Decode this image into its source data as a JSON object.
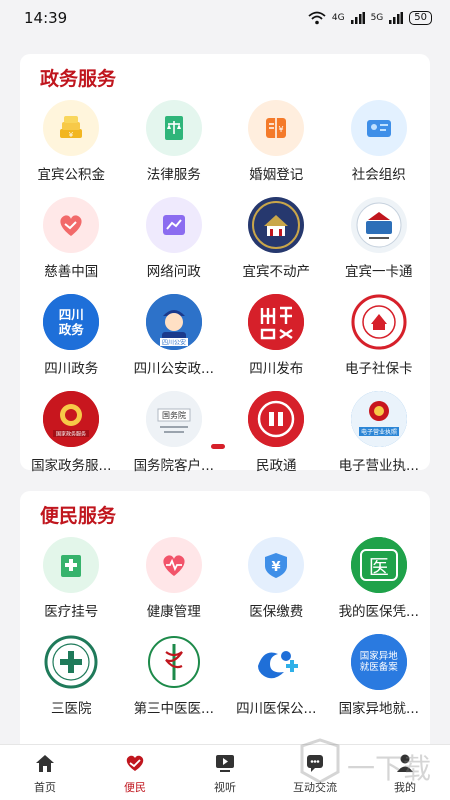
{
  "status_bar": {
    "time": "14:39",
    "signal1": "4G",
    "signal2": "5G",
    "battery": "50"
  },
  "gov_services": {
    "title": "政务服务",
    "items": [
      {
        "label": "宜宾公积金",
        "icon": "coin-stack-icon",
        "bg": "#fff5dc"
      },
      {
        "label": "法律服务",
        "icon": "law-book-icon",
        "bg": "#e4f6ee"
      },
      {
        "label": "婚姻登记",
        "icon": "certificate-book-icon",
        "bg": "#ffeede"
      },
      {
        "label": "社会组织",
        "icon": "id-card-icon",
        "bg": "#e3f1ff"
      },
      {
        "label": "慈善中国",
        "icon": "charity-heart-icon",
        "bg": "#ffe8e8"
      },
      {
        "label": "网络问政",
        "icon": "line-chart-icon",
        "bg": "#efeafd"
      },
      {
        "label": "宜宾不动产",
        "icon": "real-estate-emblem-icon",
        "bg": "#26386e"
      },
      {
        "label": "宜宾一卡通",
        "icon": "social-card-emblem-icon",
        "bg": "#eef3f7"
      },
      {
        "label": "四川政务",
        "icon": "sichuan-gov-logo-icon",
        "bg": "#1e6fd9",
        "logo_text": "四川政务"
      },
      {
        "label": "四川公安政...",
        "icon": "police-officer-icon",
        "bg": "#2d72c9",
        "logo_text": "四川公安"
      },
      {
        "label": "四川发布",
        "icon": "sichuan-release-logo-icon",
        "bg": "#d6202a"
      },
      {
        "label": "电子社保卡",
        "icon": "social-security-emblem-icon",
        "bg": "#f7eeee"
      },
      {
        "label": "国家政务服...",
        "icon": "national-emblem-icon",
        "bg": "#c8161e",
        "logo_text": "国家政务服务"
      },
      {
        "label": "国务院客户...",
        "icon": "state-council-logo-icon",
        "bg": "#eef2f6",
        "logo_text": "国务院"
      },
      {
        "label": "民政通",
        "icon": "civil-affairs-logo-icon",
        "bg": "#d6202a"
      },
      {
        "label": "电子营业执...",
        "icon": "business-license-icon",
        "bg": "#2c86d6",
        "logo_text": "电子营业执照"
      }
    ]
  },
  "public_services": {
    "title": "便民服务",
    "items": [
      {
        "label": "医疗挂号",
        "icon": "hospital-cross-icon",
        "bg": "#e3f6ea"
      },
      {
        "label": "健康管理",
        "icon": "heartbeat-icon",
        "bg": "#ffe6e8"
      },
      {
        "label": "医保缴费",
        "icon": "yuan-shield-icon",
        "bg": "#e4effd"
      },
      {
        "label": "我的医保凭...",
        "icon": "medical-yi-icon",
        "bg": "#1fa24a",
        "logo_text": "医"
      },
      {
        "label": "三医院",
        "icon": "third-hospital-logo-icon",
        "bg": "#ffffff"
      },
      {
        "label": "第三中医医...",
        "icon": "tcm-hospital-logo-icon",
        "bg": "#ffffff"
      },
      {
        "label": "四川医保公...",
        "icon": "sichuan-medical-logo-icon",
        "bg": "#ffffff"
      },
      {
        "label": "国家异地就...",
        "icon": "remote-medical-logo-icon",
        "bg": "#2a7ae0",
        "logo_text": "国家异地就医备案"
      }
    ]
  },
  "tabbar": {
    "items": [
      {
        "label": "首页",
        "icon": "home-icon"
      },
      {
        "label": "便民",
        "icon": "heart-hands-icon",
        "active": true
      },
      {
        "label": "视听",
        "icon": "play-screen-icon"
      },
      {
        "label": "互动交流",
        "icon": "chat-icon"
      },
      {
        "label": "我的",
        "icon": "user-icon"
      }
    ]
  },
  "watermark": {
    "text": "一下载"
  },
  "colors": {
    "brand_red": "#c0161e",
    "background": "#f3f3f5"
  }
}
